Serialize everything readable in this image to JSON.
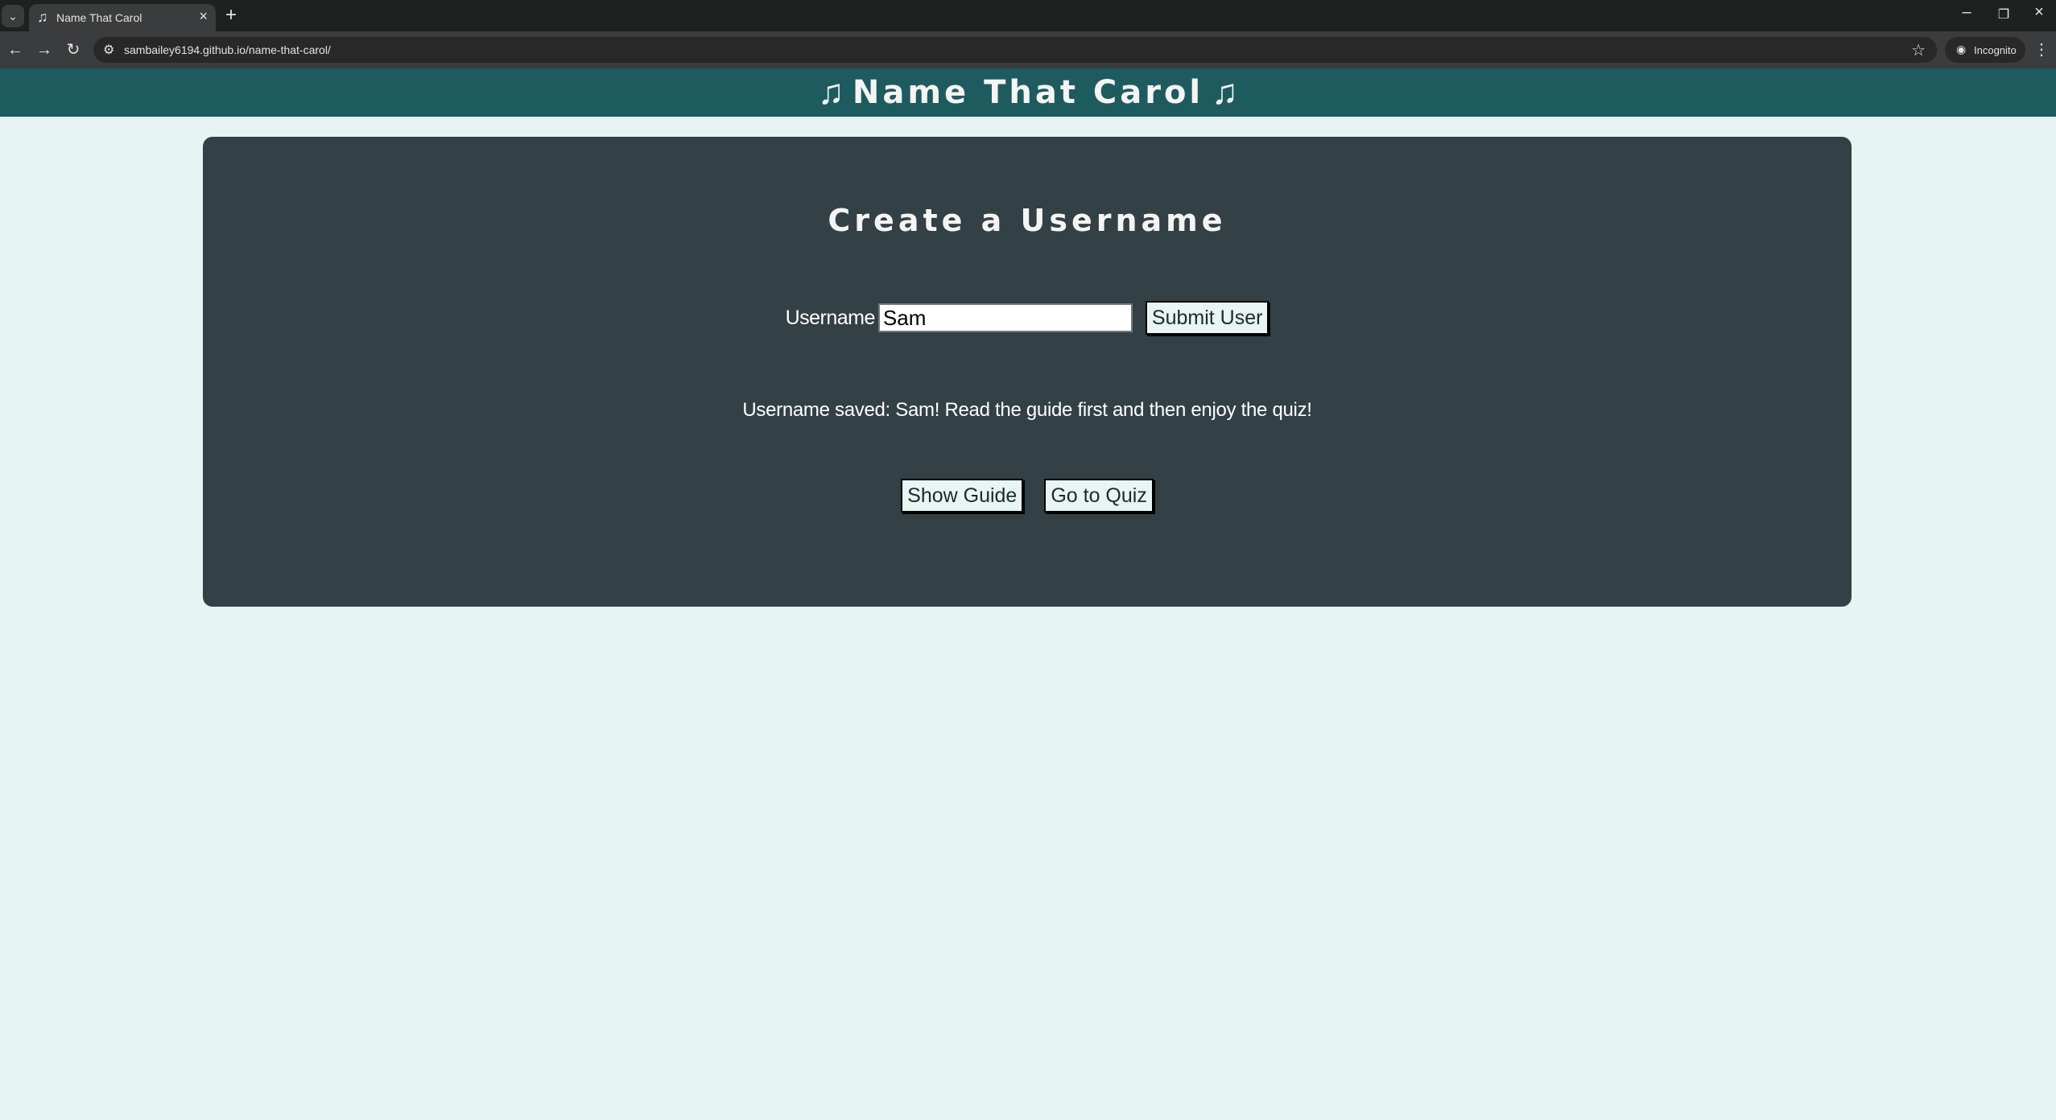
{
  "browser": {
    "tab_title": "Name That Carol",
    "tab_favicon": "♫",
    "url": "sambailey6194.github.io/name-that-carol/",
    "incognito_label": "Incognito"
  },
  "header": {
    "title": "Name That Carol",
    "note_icon": "♫"
  },
  "card": {
    "heading": "Create a Username",
    "username_label": "Username",
    "username_value": "Sam",
    "submit_label": "Submit User",
    "status_message": "Username saved: Sam! Read the guide first and then enjoy the quiz!",
    "show_guide_label": "Show Guide",
    "go_quiz_label": "Go to Quiz"
  },
  "colors": {
    "header_bg": "#1e5b5e",
    "card_bg": "#334045",
    "page_bg": "#e6f4f4"
  }
}
